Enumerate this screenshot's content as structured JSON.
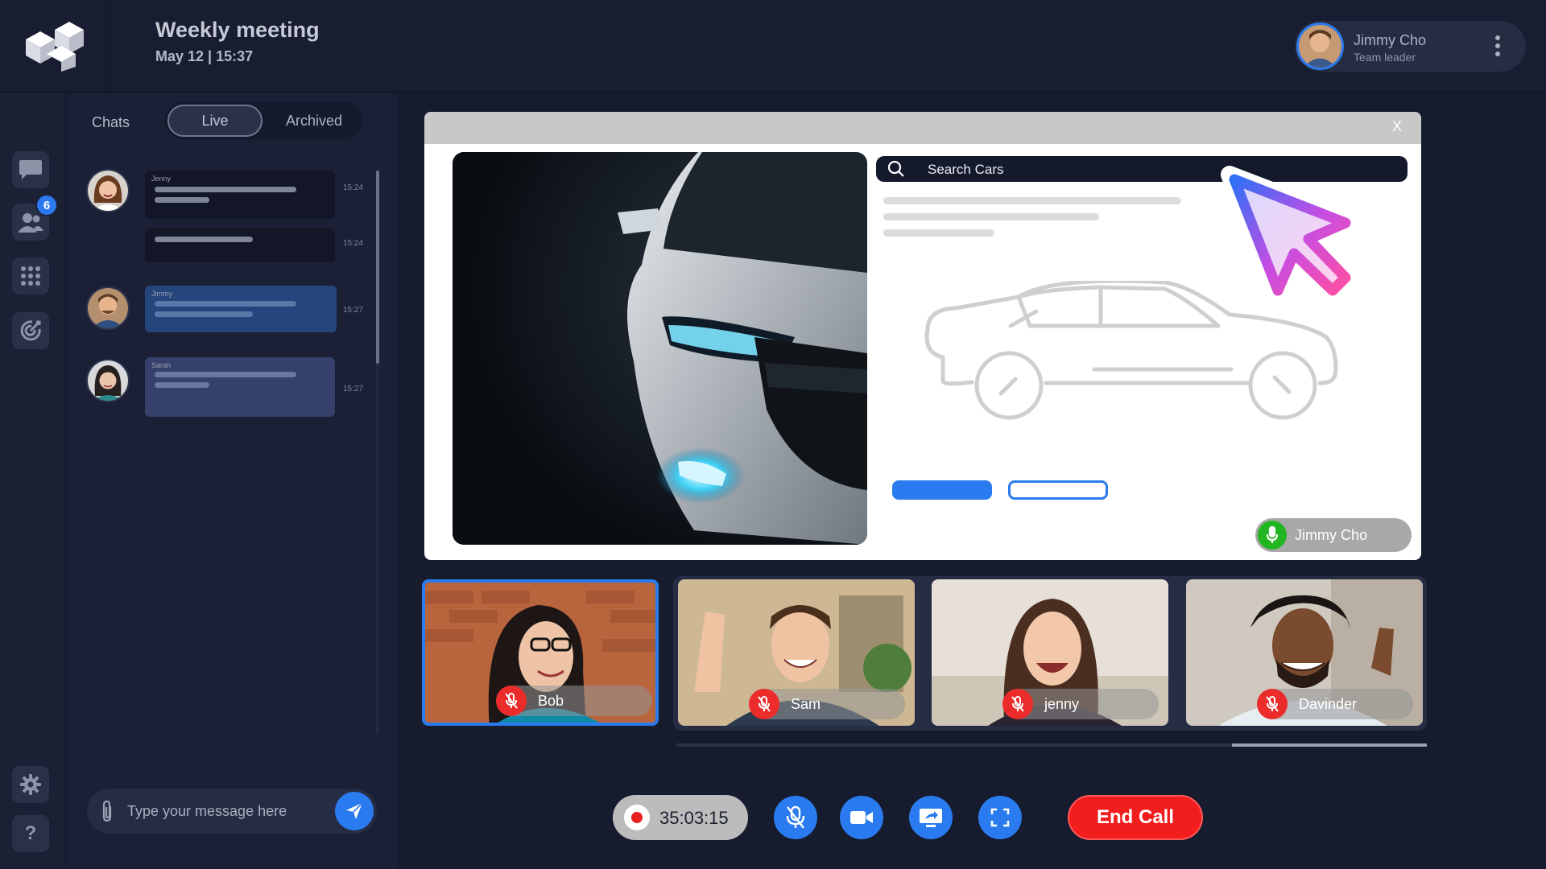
{
  "meeting": {
    "title": "Weekly meeting",
    "date_time": "May 12 |  15:37"
  },
  "user": {
    "name": "Jimmy Cho",
    "role": "Team leader"
  },
  "rail": {
    "badge_count": "6",
    "icons": [
      "chat-icon",
      "contacts-icon",
      "dialpad-icon",
      "target-icon",
      "gear-icon",
      "help-icon"
    ],
    "help_label": "?"
  },
  "chat": {
    "tabs": {
      "chats": "Chats",
      "live": "Live",
      "archived": "Archived"
    },
    "messages": [
      {
        "sender": "Jenny",
        "time": "15:24"
      },
      {
        "sender": "",
        "time": "15:24"
      },
      {
        "sender": "Jimmy",
        "time": "15:27"
      },
      {
        "sender": "Sarah",
        "time": "15:27"
      }
    ],
    "composer_placeholder": "Type your message here"
  },
  "share": {
    "close_label": "X",
    "search_text": "Search Cars",
    "speaker": "Jimmy Cho"
  },
  "participants": [
    {
      "name": "Bob"
    },
    {
      "name": "Sam"
    },
    {
      "name": "jenny"
    },
    {
      "name": "Davinder"
    }
  ],
  "controls": {
    "timer": "35:03:15",
    "end_call": "End Call"
  },
  "colors": {
    "accent": "#2a7bf0",
    "danger": "#f21d1d",
    "speaking": "#22b522",
    "background": "#161b2e"
  }
}
